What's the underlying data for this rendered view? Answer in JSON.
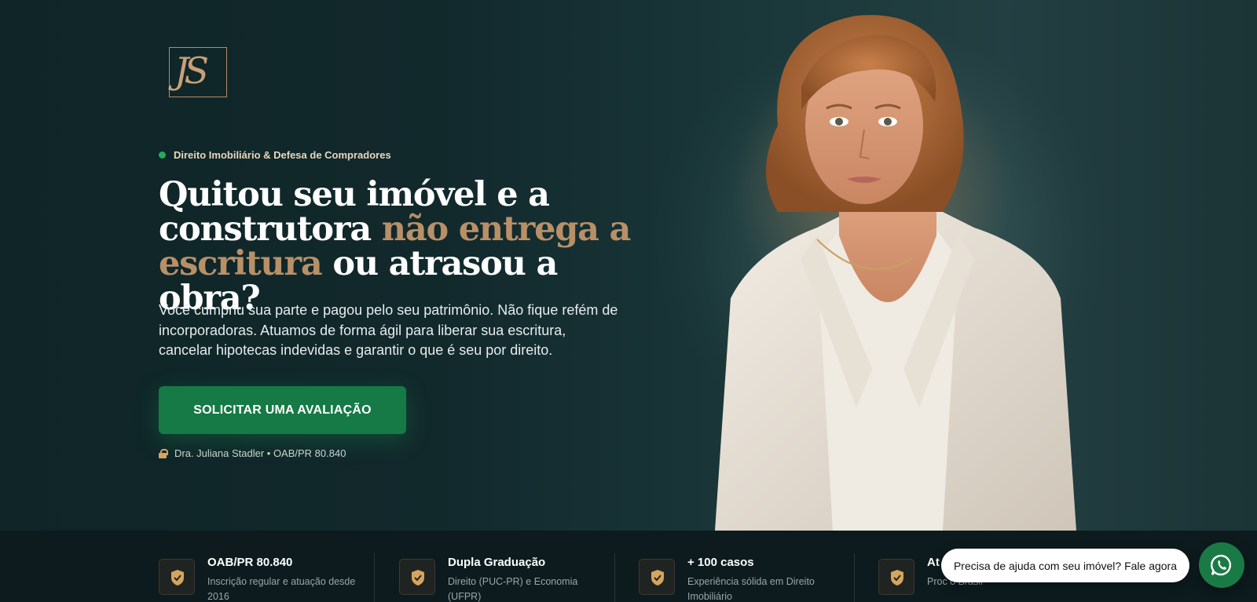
{
  "logo": {
    "monogram": "JS"
  },
  "hero": {
    "eyebrow": "Direito Imobiliário & Defesa de Compradores",
    "headline": {
      "line1": "Quitou seu imóvel e a",
      "line2_start": "construtora ",
      "line2_accent": "não entrega a",
      "line3_accent": "escritura",
      "line3_end": " ou atrasou a obra?"
    },
    "lead": "Você cumpriu sua parte e pagou pelo seu patrimônio. Não fique refém de incorporadoras. Atuamos de forma ágil para liberar sua escritura, cancelar hipotecas indevidas e garantir o que é seu por direito.",
    "cta_label": "SOLICITAR UMA AVALIAÇÃO",
    "credential": "Dra. Juliana Stadler • OAB/PR 80.840"
  },
  "stats": [
    {
      "title": "OAB/PR 80.840",
      "desc": "Inscrição regular e atuação desde 2016"
    },
    {
      "title": "Dupla Graduação",
      "desc": "Direito (PUC-PR) e Economia (UFPR)"
    },
    {
      "title": "+ 100 casos",
      "desc": "Experiência sólida em Direito Imobiliário"
    },
    {
      "title": "At",
      "desc": "Proc o Brasil"
    }
  ],
  "chat": {
    "prompt": "Precisa de ajuda com seu imóvel? Fale agora"
  },
  "colors": {
    "accent_gold": "#b89068",
    "cta_green": "#157a45",
    "dot_green": "#1fae5c"
  },
  "icons": {
    "badge": "shield-check-icon",
    "whatsapp": "whatsapp-icon",
    "lock": "lock-icon"
  }
}
